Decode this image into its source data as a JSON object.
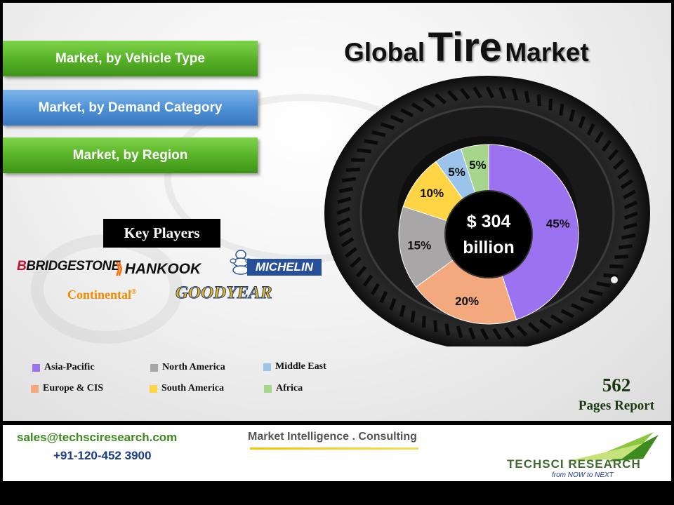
{
  "sidebar": {
    "buttons": [
      {
        "label": "Market, by Vehicle Type",
        "color": "#55b026"
      },
      {
        "label": "Market, by Demand Category",
        "color": "#4c8fd5"
      },
      {
        "label": "Market, by Region",
        "color": "#55b026"
      }
    ]
  },
  "title": {
    "part1": "Global",
    "part2": "Tire",
    "part3": "Market"
  },
  "chart_data": {
    "type": "pie",
    "center_label_line1": "$ 304",
    "center_label_line2": "billion",
    "slices": [
      {
        "name": "Asia-Pacific",
        "value": 45,
        "label": "45%",
        "color": "#9b72ef"
      },
      {
        "name": "Europe & CIS",
        "value": 20,
        "label": "20%",
        "color": "#f3a87e"
      },
      {
        "name": "North America",
        "value": 15,
        "label": "15%",
        "color": "#a8a6a6"
      },
      {
        "name": "South America",
        "value": 10,
        "label": "10%",
        "color": "#ffd445"
      },
      {
        "name": "Middle East",
        "value": 5,
        "label": "5%",
        "color": "#9cc3ea"
      },
      {
        "name": "Africa",
        "value": 5,
        "label": "5%",
        "color": "#a6d58c"
      }
    ],
    "legend": [
      {
        "name": "Asia-Pacific",
        "color": "#9b72ef"
      },
      {
        "name": "North America",
        "color": "#a8a6a6"
      },
      {
        "name": "Middle East",
        "color": "#9cc3ea"
      },
      {
        "name": "Europe  & CIS",
        "color": "#f3a87e"
      },
      {
        "name": "South America",
        "color": "#ffd445"
      },
      {
        "name": "Africa",
        "color": "#a6d58c"
      }
    ]
  },
  "key_players": {
    "heading": "Key Players",
    "logos": [
      "BRIDGESTONE",
      "HANKOOK",
      "MICHELIN",
      "Continental",
      "GOODYEAR"
    ],
    "continental_mark": "®"
  },
  "report": {
    "pages": "562",
    "label": "Pages Report"
  },
  "footer": {
    "email": "sales@techsciresearch.com",
    "phone": "+91-120-452 3900",
    "tagline": "Market Intelligence . Consulting",
    "brand": "TECHSCI RESEARCH",
    "brand_sub": "from NOW to NEXT"
  }
}
